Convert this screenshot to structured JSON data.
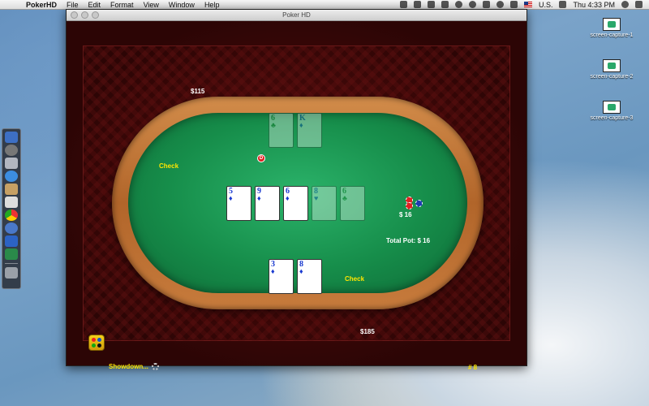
{
  "menubar": {
    "app_name": "PokerHD",
    "items": [
      "File",
      "Edit",
      "Format",
      "View",
      "Window",
      "Help"
    ],
    "input_source": "U.S.",
    "clock": "Thu 4:33 PM"
  },
  "desktop": {
    "icons": [
      "screen-capture-1",
      "screen-capture-2",
      "screen-capture-3"
    ]
  },
  "window": {
    "title": "Poker HD"
  },
  "table": {
    "top_player_stack": "$115",
    "top_player_action": "Check",
    "bottom_player_stack": "$185",
    "bottom_player_action": "Check",
    "dealer_button": "D",
    "bet_amount": "$ 16",
    "total_pot": "Total Pot: $ 16",
    "status": "Showdown...",
    "hand_number": "# 8"
  },
  "cards": {
    "opponent": [
      {
        "rank": "6",
        "suit": "♣"
      },
      {
        "rank": "K",
        "suit": "♦"
      }
    ],
    "board": [
      {
        "rank": "5",
        "suit": "♦"
      },
      {
        "rank": "9",
        "suit": "♦"
      },
      {
        "rank": "6",
        "suit": "♦"
      },
      {
        "rank": "8",
        "suit": "♥"
      },
      {
        "rank": "6",
        "suit": "♣"
      }
    ],
    "player": [
      {
        "rank": "3",
        "suit": "♦"
      },
      {
        "rank": "8",
        "suit": "♦"
      }
    ]
  },
  "colors": {
    "label_yellow": "#ffe600",
    "felt": "#168d4a",
    "rail": "#b1652a",
    "card_text": "#1a3ad0"
  }
}
